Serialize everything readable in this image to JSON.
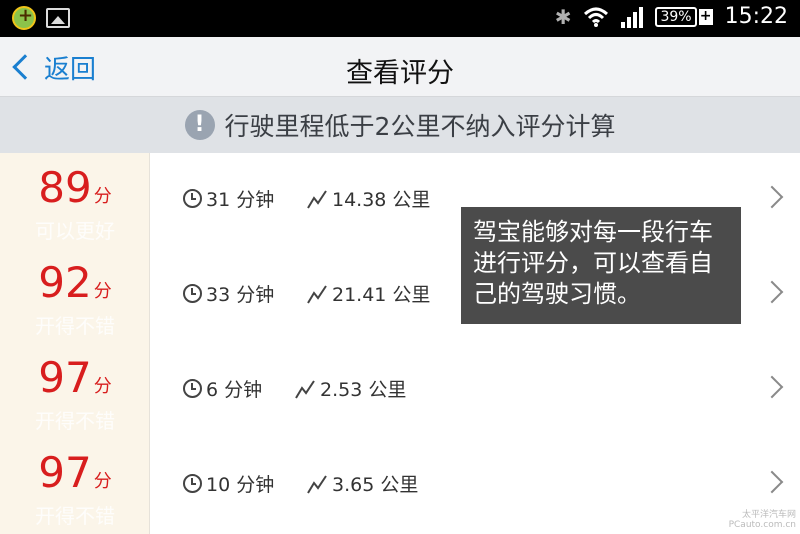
{
  "status_bar": {
    "battery_percent": "39%",
    "battery_charging_symbol": "+",
    "time": "15:22",
    "icons": [
      "app-notification-icon",
      "image-notification-icon",
      "bluetooth-icon",
      "wifi-icon",
      "signal-icon",
      "battery-icon"
    ]
  },
  "header": {
    "back_label": "返回",
    "title": "查看评分"
  },
  "notice": {
    "icon_glyph": "!",
    "text": "行驶里程低于2公里不纳入评分计算"
  },
  "trips": [
    {
      "score": "89",
      "unit": "分",
      "label": "可以更好",
      "duration": "31 分钟",
      "distance": "14.38 公里"
    },
    {
      "score": "92",
      "unit": "分",
      "label": "开得不错",
      "duration": "33 分钟",
      "distance": "21.41 公里"
    },
    {
      "score": "97",
      "unit": "分",
      "label": "开得不错",
      "duration": "6 分钟",
      "distance": "2.53 公里"
    },
    {
      "score": "97",
      "unit": "分",
      "label": "开得不错",
      "duration": "10 分钟",
      "distance": "3.65 公里"
    }
  ],
  "annotation": {
    "text": "驾宝能够对每一段行车进行评分，可以查看自己的驾驶习惯。"
  },
  "watermark": {
    "line1": "太平洋汽车网",
    "line2": "PCauto.com.cn"
  },
  "colors": {
    "score_red": "#d81e1e",
    "accent_blue": "#1a7fd0",
    "score_column_bg": "#fbf5e9"
  }
}
